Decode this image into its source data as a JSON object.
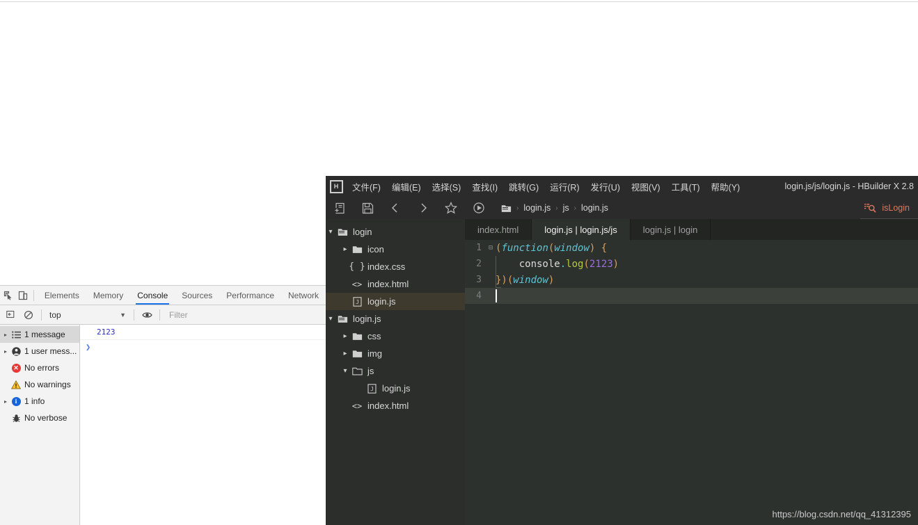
{
  "devtools": {
    "toolbar_icons": [
      {
        "name": "inspect-element-icon",
        "glyph": "↖"
      },
      {
        "name": "device-toolbar-icon",
        "glyph": "▭"
      }
    ],
    "tabs": [
      {
        "label": "Elements",
        "active": false
      },
      {
        "label": "Memory",
        "active": false
      },
      {
        "label": "Console",
        "active": true
      },
      {
        "label": "Sources",
        "active": false
      },
      {
        "label": "Performance",
        "active": false
      },
      {
        "label": "Network",
        "active": false
      }
    ],
    "filterbar": {
      "clear_icon": "clear-console-icon",
      "block_icon": "no-entry-icon",
      "context": "top",
      "caret": "▼",
      "eye_icon": "eye-icon",
      "filter_placeholder": "Filter"
    },
    "sidebar": {
      "items": [
        {
          "label": "1 message",
          "icon": "list-icon",
          "expandable": true,
          "selected": true
        },
        {
          "label": "1 user mess...",
          "icon": "user-icon",
          "expandable": true,
          "selected": false
        },
        {
          "label": "No errors",
          "icon": "error-icon",
          "expandable": false,
          "selected": false
        },
        {
          "label": "No warnings",
          "icon": "warning-icon",
          "expandable": false,
          "selected": false
        },
        {
          "label": "1 info",
          "icon": "info-icon",
          "expandable": true,
          "selected": false
        },
        {
          "label": "No verbose",
          "icon": "bug-icon",
          "expandable": false,
          "selected": false
        }
      ]
    },
    "console": {
      "messages": [
        "2123"
      ],
      "prompt": "❯"
    },
    "colors": {
      "accent": "#1a73e8",
      "message_text": "#2a29cc",
      "panel_bg": "#f3f3f3"
    }
  },
  "hbuilder": {
    "window_title": "login.js/js/login.js - HBuilder X 2.8",
    "logo": "H",
    "menu": [
      {
        "label": "文件(F)",
        "mnemonic": "F"
      },
      {
        "label": "编辑(E)",
        "mnemonic": "E"
      },
      {
        "label": "选择(S)",
        "mnemonic": "S"
      },
      {
        "label": "查找(I)",
        "mnemonic": "I"
      },
      {
        "label": "跳转(G)",
        "mnemonic": "G"
      },
      {
        "label": "运行(R)",
        "mnemonic": "R"
      },
      {
        "label": "发行(U)",
        "mnemonic": "U"
      },
      {
        "label": "视图(V)",
        "mnemonic": "V"
      },
      {
        "label": "工具(T)",
        "mnemonic": "T"
      },
      {
        "label": "帮助(Y)",
        "mnemonic": "Y"
      }
    ],
    "toolbar": {
      "icons": [
        {
          "name": "new-file-icon"
        },
        {
          "name": "save-icon"
        },
        {
          "name": "back-icon"
        },
        {
          "name": "forward-icon"
        },
        {
          "name": "favorite-star-icon"
        },
        {
          "name": "run-icon"
        }
      ],
      "breadcrumb": {
        "folder_icon": "folder-icon",
        "separator": "›",
        "parts": [
          "login.js",
          "js",
          "login.js"
        ]
      },
      "search": {
        "icon": "search-icon",
        "text": "isLogin",
        "color": "#e1775c"
      }
    },
    "tree": [
      {
        "label": "login",
        "depth": 0,
        "arrow": "⌄",
        "icon": "folder-open-icon",
        "selected": false
      },
      {
        "label": "icon",
        "depth": 1,
        "arrow": "›",
        "icon": "folder-icon",
        "selected": false
      },
      {
        "label": "index.css",
        "depth": 1,
        "arrow": "",
        "icon": "css-file-icon",
        "selected": false
      },
      {
        "label": "index.html",
        "depth": 1,
        "arrow": "",
        "icon": "html-file-icon",
        "selected": false
      },
      {
        "label": "login.js",
        "depth": 1,
        "arrow": "",
        "icon": "js-file-icon",
        "selected": true
      },
      {
        "label": "login.js",
        "depth": 0,
        "arrow": "⌄",
        "icon": "folder-open-icon",
        "selected": false
      },
      {
        "label": "css",
        "depth": 1,
        "arrow": "›",
        "icon": "folder-icon",
        "selected": false
      },
      {
        "label": "img",
        "depth": 1,
        "arrow": "›",
        "icon": "folder-icon",
        "selected": false
      },
      {
        "label": "js",
        "depth": 1,
        "arrow": "⌄",
        "icon": "folder-open-icon",
        "selected": false
      },
      {
        "label": "login.js",
        "depth": 2,
        "arrow": "",
        "icon": "js-file-icon",
        "selected": false
      },
      {
        "label": "index.html",
        "depth": 1,
        "arrow": "",
        "icon": "html-file-icon",
        "selected": false
      }
    ],
    "editor": {
      "tabs": [
        {
          "label": "index.html",
          "active": false
        },
        {
          "label": "login.js | login.js/js",
          "active": true
        },
        {
          "label": "login.js | login",
          "active": false
        }
      ],
      "lines": [
        {
          "number": "1",
          "fold": "⊟",
          "active": false
        },
        {
          "number": "2",
          "fold": "",
          "active": false
        },
        {
          "number": "3",
          "fold": "",
          "active": false
        },
        {
          "number": "4",
          "fold": "",
          "active": true
        }
      ],
      "code": {
        "l1": {
          "p1": "(",
          "kw1": "function",
          "p2": "(",
          "kw2": "window",
          "p3": ")",
          "brace": " {"
        },
        "l2": {
          "obj": "console",
          "dot": ".",
          "fn": "log",
          "p1": "(",
          "num": "2123",
          "p2": ")"
        },
        "l3": {
          "brace": "})",
          "p1": "(",
          "kw": "window",
          "p2": ")"
        }
      },
      "colors": {
        "bg": "#2d312d",
        "keyword": "#5fc4d6",
        "paren": "#d9a05b",
        "function": "#b5cc3a",
        "number": "#9a6ede",
        "plain": "#dcdcdc"
      }
    },
    "watermark": "https://blog.csdn.net/qq_41312395"
  }
}
